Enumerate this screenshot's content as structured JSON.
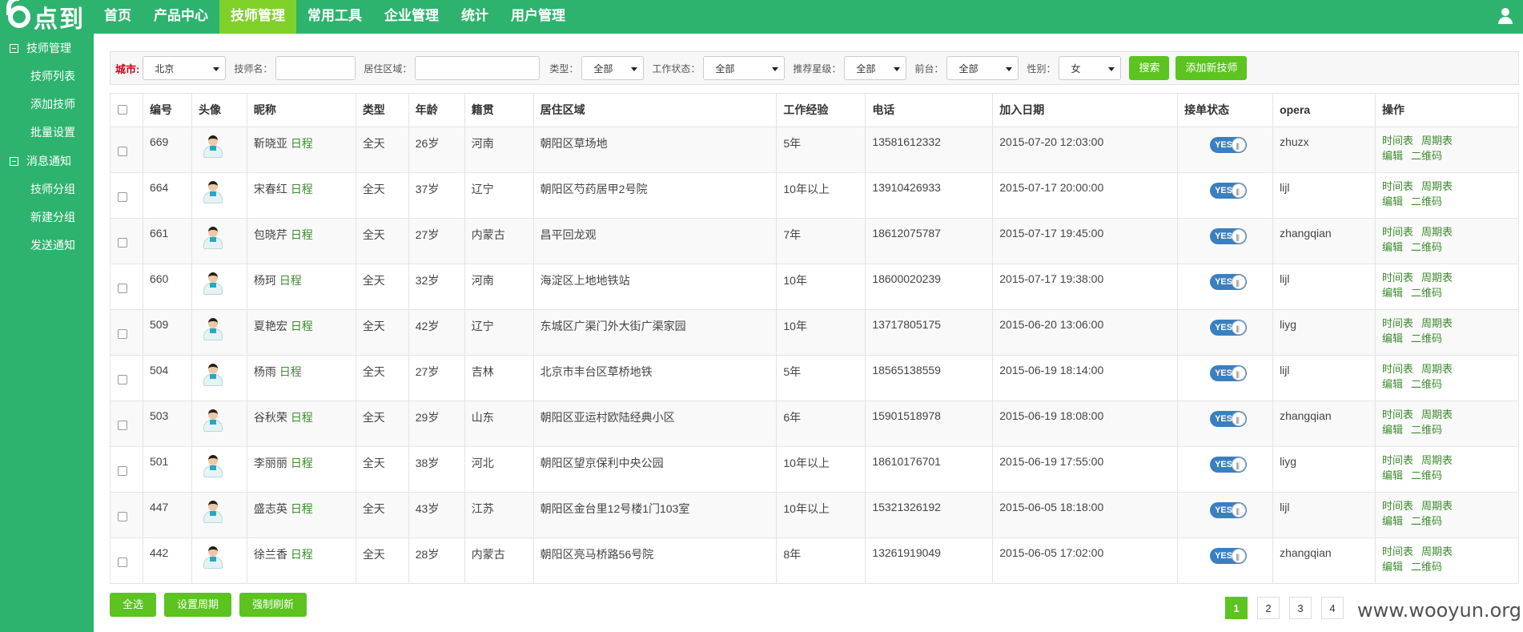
{
  "brand": {
    "logo_text": "点到"
  },
  "nav": [
    "首页",
    "产品中心",
    "技师管理",
    "常用工具",
    "企业管理",
    "统计",
    "用户管理"
  ],
  "sidebar": {
    "group1": "技师管理",
    "items1": [
      "技师列表",
      "添加技师",
      "批量设置"
    ],
    "group2": "消息通知",
    "items2": [
      "技师分组",
      "新建分组",
      "发送通知"
    ]
  },
  "filter": {
    "city_label": "城市:",
    "city_value": "北京",
    "name_label": "技师名：",
    "area_label": "居住区域：",
    "type_label": "类型：",
    "type_value": "全部",
    "status_label": "工作状态：",
    "status_value": "全部",
    "star_label": "推荐星级：",
    "star_value": "全部",
    "front_label": "前台：",
    "front_value": "全部",
    "gender_label": "性别：",
    "gender_value": "女",
    "search_btn": "搜索",
    "add_btn": "添加新技师"
  },
  "table": {
    "headers": [
      "编号",
      "头像",
      "昵称",
      "类型",
      "年龄",
      "籍贯",
      "居住区域",
      "工作经验",
      "电话",
      "加入日期",
      "接单状态",
      "opera",
      "操作"
    ],
    "schedule_link": "日程",
    "toggle_text": "YES",
    "ops": [
      "时间表",
      "周期表",
      "编辑",
      "二维码"
    ],
    "rows": [
      {
        "id": "669",
        "name": "靳晓亚",
        "type": "全天",
        "age": "26岁",
        "origin": "河南",
        "area": "朝阳区草场地",
        "exp": "5年",
        "phone": "13581612332",
        "date": "2015-07-20 12:03:00",
        "opera": "zhuzx"
      },
      {
        "id": "664",
        "name": "宋春红",
        "type": "全天",
        "age": "37岁",
        "origin": "辽宁",
        "area": "朝阳区芍药居甲2号院",
        "exp": "10年以上",
        "phone": "13910426933",
        "date": "2015-07-17 20:00:00",
        "opera": "lijl"
      },
      {
        "id": "661",
        "name": "包晓芹",
        "type": "全天",
        "age": "27岁",
        "origin": "内蒙古",
        "area": "昌平回龙观",
        "exp": "7年",
        "phone": "18612075787",
        "date": "2015-07-17 19:45:00",
        "opera": "zhangqian"
      },
      {
        "id": "660",
        "name": "杨珂",
        "type": "全天",
        "age": "32岁",
        "origin": "河南",
        "area": "海淀区上地地铁站",
        "exp": "10年",
        "phone": "18600020239",
        "date": "2015-07-17 19:38:00",
        "opera": "lijl"
      },
      {
        "id": "509",
        "name": "夏艳宏",
        "type": "全天",
        "age": "42岁",
        "origin": "辽宁",
        "area": "东城区广渠门外大街广渠家园",
        "exp": "10年",
        "phone": "13717805175",
        "date": "2015-06-20 13:06:00",
        "opera": "liyg"
      },
      {
        "id": "504",
        "name": "杨雨",
        "type": "全天",
        "age": "27岁",
        "origin": "吉林",
        "area": "北京市丰台区草桥地铁",
        "exp": "5年",
        "phone": "18565138559",
        "date": "2015-06-19 18:14:00",
        "opera": "lijl"
      },
      {
        "id": "503",
        "name": "谷秋荣",
        "type": "全天",
        "age": "29岁",
        "origin": "山东",
        "area": "朝阳区亚运村欧陆经典小区",
        "exp": "6年",
        "phone": "15901518978",
        "date": "2015-06-19 18:08:00",
        "opera": "zhangqian"
      },
      {
        "id": "501",
        "name": "李丽丽",
        "type": "全天",
        "age": "38岁",
        "origin": "河北",
        "area": "朝阳区望京保利中央公园",
        "exp": "10年以上",
        "phone": "18610176701",
        "date": "2015-06-19 17:55:00",
        "opera": "liyg"
      },
      {
        "id": "447",
        "name": "盛志英",
        "type": "全天",
        "age": "43岁",
        "origin": "江苏",
        "area": "朝阳区金台里12号楼1门103室",
        "exp": "10年以上",
        "phone": "15321326192",
        "date": "2015-06-05 18:18:00",
        "opera": "lijl"
      },
      {
        "id": "442",
        "name": "徐兰香",
        "type": "全天",
        "age": "28岁",
        "origin": "内蒙古",
        "area": "朝阳区亮马桥路56号院",
        "exp": "8年",
        "phone": "13261919049",
        "date": "2015-06-05 17:02:00",
        "opera": "zhangqian"
      }
    ]
  },
  "bottom": {
    "select_all": "全选",
    "set_period": "设置周期",
    "force_refresh": "强制刷新"
  },
  "pager": [
    "1",
    "2",
    "3",
    "4"
  ],
  "watermark": "www.wooyun.org",
  "colors": {
    "brand_green": "#2db36e",
    "active_nav": "#7fd12a",
    "button_green": "#5cc321",
    "toggle_blue": "#3a7fc0"
  }
}
